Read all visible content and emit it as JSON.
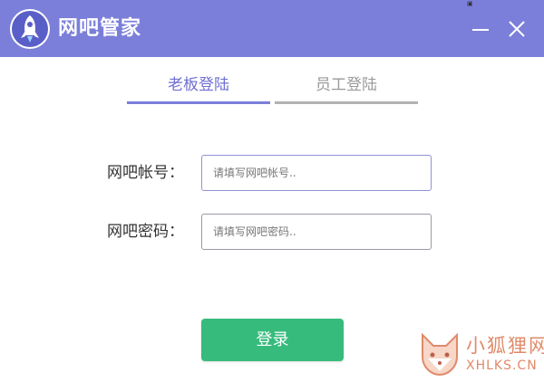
{
  "window": {
    "title": "网吧管家",
    "brand_color": "#7b7fd9",
    "minimize_icon": "minimize-icon",
    "close_icon": "close-icon"
  },
  "tabs": [
    {
      "label": "老板登陆",
      "active": true
    },
    {
      "label": "员工登陆",
      "active": false
    }
  ],
  "form": {
    "account_label": "网吧帐号：",
    "account_placeholder": "请填写网吧帐号..",
    "account_value": "",
    "password_label": "网吧密码：",
    "password_placeholder": "请填写网吧密码..",
    "password_value": "",
    "submit_label": "登录",
    "submit_color": "#36bb7c"
  },
  "watermark": {
    "text_cn": "小狐狸网",
    "text_en": "XHLKS.CN"
  }
}
